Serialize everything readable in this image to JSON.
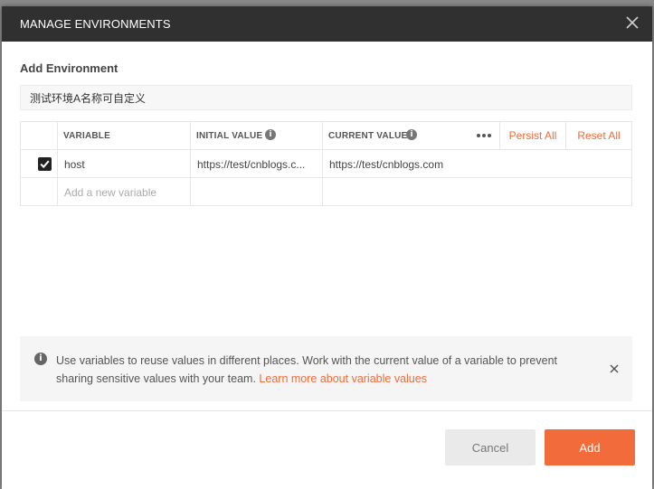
{
  "dialog": {
    "title": "MANAGE ENVIRONMENTS",
    "section_label": "Add Environment",
    "environment_name_value": "测试环境A名称可自定义"
  },
  "table": {
    "headers": {
      "variable": "VARIABLE",
      "initial_value": "INITIAL VALUE",
      "current_value": "CURRENT VALUE"
    },
    "actions": {
      "persist_all": "Persist All",
      "reset_all": "Reset All"
    },
    "rows": [
      {
        "checked": true,
        "variable": "host",
        "initial_value": "https://test/cnblogs.c...",
        "current_value": "https://test/cnblogs.com"
      }
    ],
    "new_variable_placeholder": "Add a new variable"
  },
  "banner": {
    "text": "Use variables to reuse values in different places. Work with the current value of a variable to prevent sharing sensitive values with your team.",
    "link_text": "Learn more about variable values"
  },
  "footer": {
    "cancel_label": "Cancel",
    "add_label": "Add"
  },
  "icons": {
    "close": "close-icon",
    "info": "info-icon",
    "more": "more-horizontal-icon",
    "checkbox": "checkmark-icon"
  },
  "colors": {
    "accent": "#f26b3a",
    "header_bg": "#303030"
  }
}
